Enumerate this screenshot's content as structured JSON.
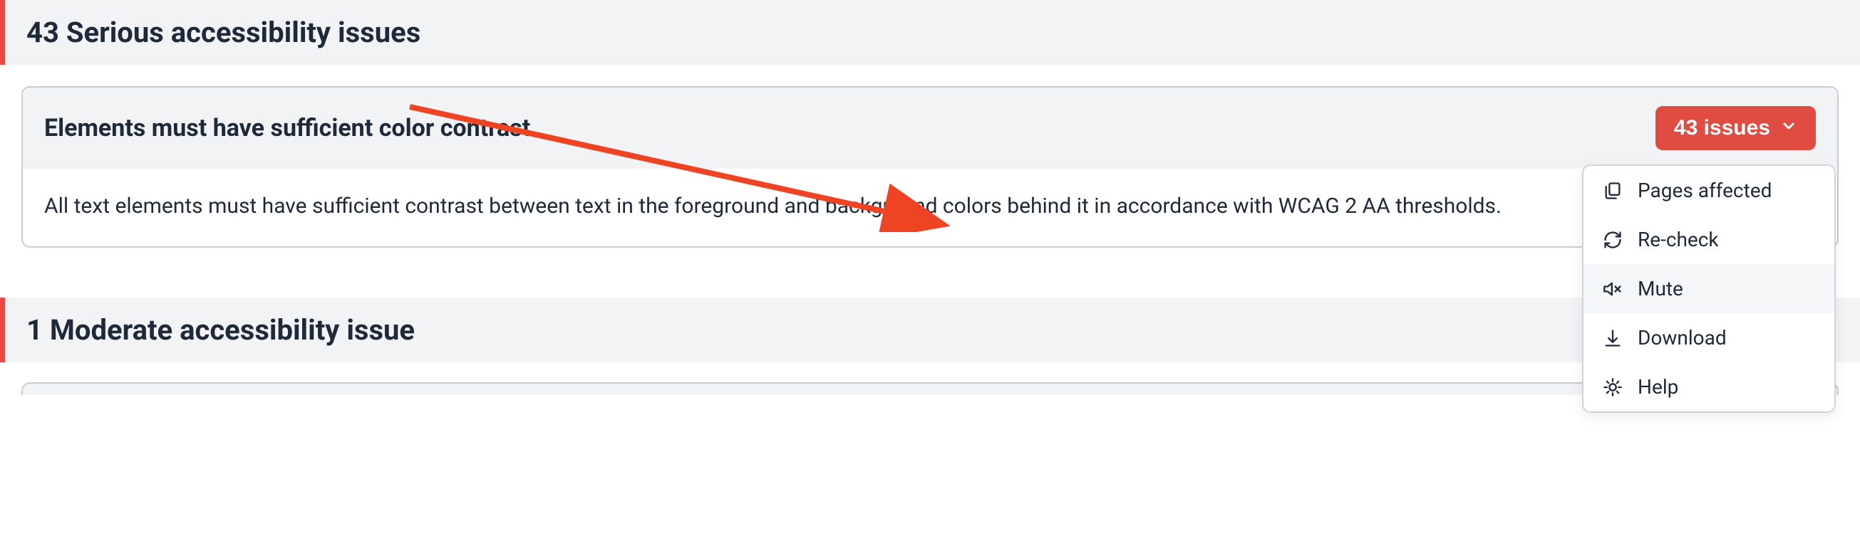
{
  "sections": {
    "serious": {
      "title": "43 Serious accessibility issues"
    },
    "moderate": {
      "title": "1 Moderate accessibility issue"
    }
  },
  "card": {
    "title": "Elements must have sufficient color contrast",
    "description": "All text elements must have sufficient contrast between text in the foreground and background colors behind it in accordance with WCAG 2 AA thresholds.",
    "button_label": "43 issues"
  },
  "dropdown": {
    "pages_affected": "Pages affected",
    "recheck": "Re-check",
    "mute": "Mute",
    "download": "Download",
    "help": "Help"
  },
  "colors": {
    "accent": "#e04b42",
    "border_accent": "#e94a46"
  }
}
